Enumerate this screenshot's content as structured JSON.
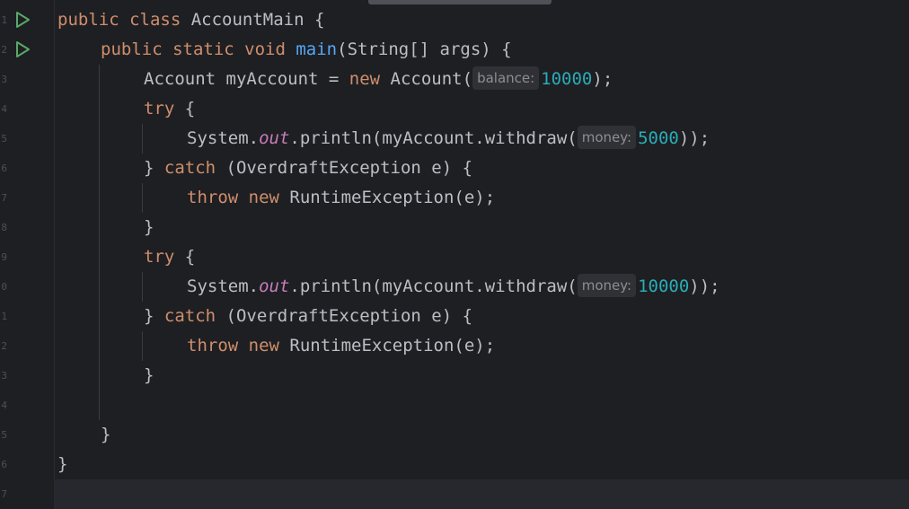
{
  "editor": {
    "gutter": {
      "line_numbers": [
        "1",
        "2",
        "3",
        "4",
        "5",
        "6",
        "7",
        "8",
        "9",
        "0",
        "1",
        "2",
        "3",
        "4",
        "5",
        "6",
        "7"
      ],
      "run_icons": [
        "run-class-icon",
        "run-main-icon"
      ]
    },
    "colors": {
      "background": "#1e1f22",
      "keyword": "#cf8e6d",
      "method_declaration": "#56a8f5",
      "static_field": "#c77dbb",
      "number": "#2aacb8",
      "text": "#bcbec4",
      "run_icon": "#59a869"
    },
    "code": {
      "l1_kw": "public class",
      "l1_rest": " AccountMain {",
      "l2_kw": "public static void",
      "l2_fn": "main",
      "l2_rest": "(String[] args) {",
      "l3_pre": "Account myAccount = ",
      "l3_kw": "new",
      "l3_mid": " Account(",
      "l3_hint": "balance:",
      "l3_num": "10000",
      "l3_post": ");",
      "l4_kw": "try",
      "l4_post": " {",
      "l5_pre": "System.",
      "l5_field": "out",
      "l5_mid": ".println(myAccount.withdraw(",
      "l5_hint": "money:",
      "l5_num": "5000",
      "l5_post": "));",
      "l6_pre": "} ",
      "l6_kw": "catch",
      "l6_post": " (OverdraftException e) {",
      "l7_kw": "throw new",
      "l7_post": " RuntimeException(e);",
      "l8": "}",
      "l9_kw": "try",
      "l9_post": " {",
      "l10_pre": "System.",
      "l10_field": "out",
      "l10_mid": ".println(myAccount.withdraw(",
      "l10_hint": "money:",
      "l10_num": "10000",
      "l10_post": "));",
      "l11_pre": "} ",
      "l11_kw": "catch",
      "l11_post": " (OverdraftException e) {",
      "l12_kw": "throw new",
      "l12_post": " RuntimeException(e);",
      "l13": "}",
      "l15": "}",
      "l16": "}"
    }
  }
}
